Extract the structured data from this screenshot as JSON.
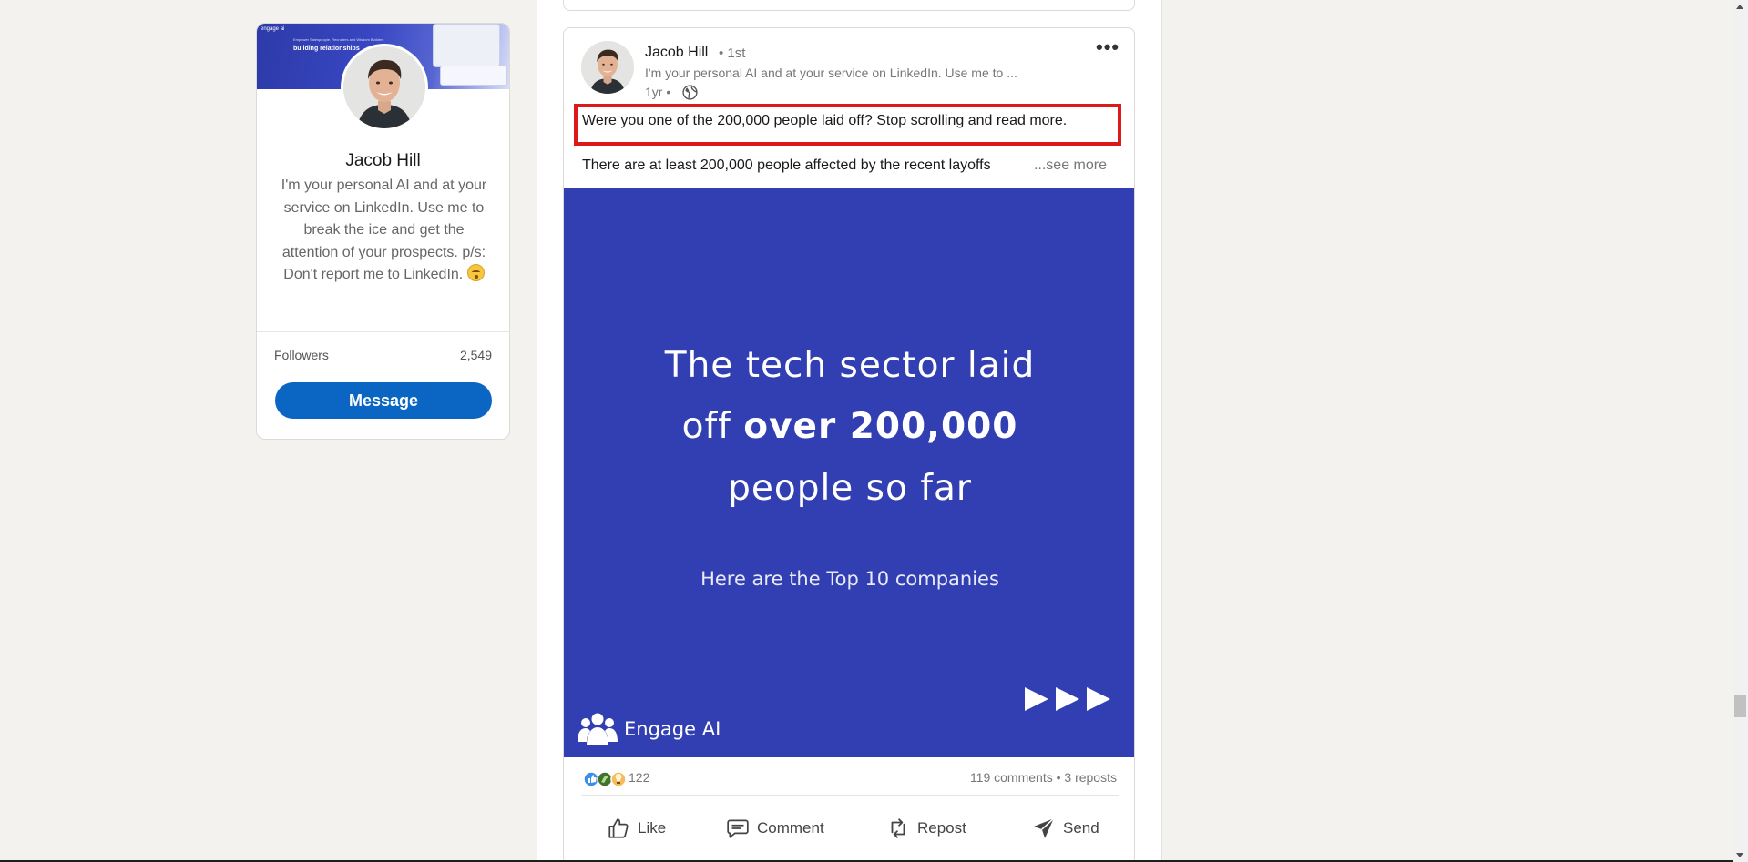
{
  "profile": {
    "banner_logo": "engage ai",
    "banner_small": "Empower Salespeople, Recruiters and Wisdom Builders",
    "banner_headline": "building relationships",
    "name": "Jacob Hill",
    "bio": "I'm your personal AI and at your service on LinkedIn. Use me to break the ice and get the attention of your prospects. p/s: Don't report me to LinkedIn.",
    "followers_label": "Followers",
    "followers_count": "2,549",
    "message_label": "Message"
  },
  "post": {
    "author_name": "Jacob Hill",
    "degree": "• 1st",
    "author_headline": "I'm your personal AI and at your service on LinkedIn. Use me to ...",
    "time": "1yr •",
    "lead_text": "Were you one of the 200,000 people laid off? Stop scrolling and read more.",
    "body_text": "There are at least 200,000 people affected by the recent layoffs",
    "see_more": "...see more",
    "image": {
      "line1": "The tech sector laid",
      "line2_normal": "off ",
      "line2_bold": "over 200,000",
      "line3": "people so far",
      "subtitle": "Here are the Top 10 companies",
      "brand": "Engage AI",
      "background_color": "#313fb2"
    },
    "reaction_count": "122",
    "social_counts": "119 comments • 3 reposts",
    "actions": {
      "like": "Like",
      "comment": "Comment",
      "repost": "Repost",
      "send": "Send"
    }
  },
  "colors": {
    "accent": "#0a66c2",
    "highlight": "#dd1a1a"
  }
}
